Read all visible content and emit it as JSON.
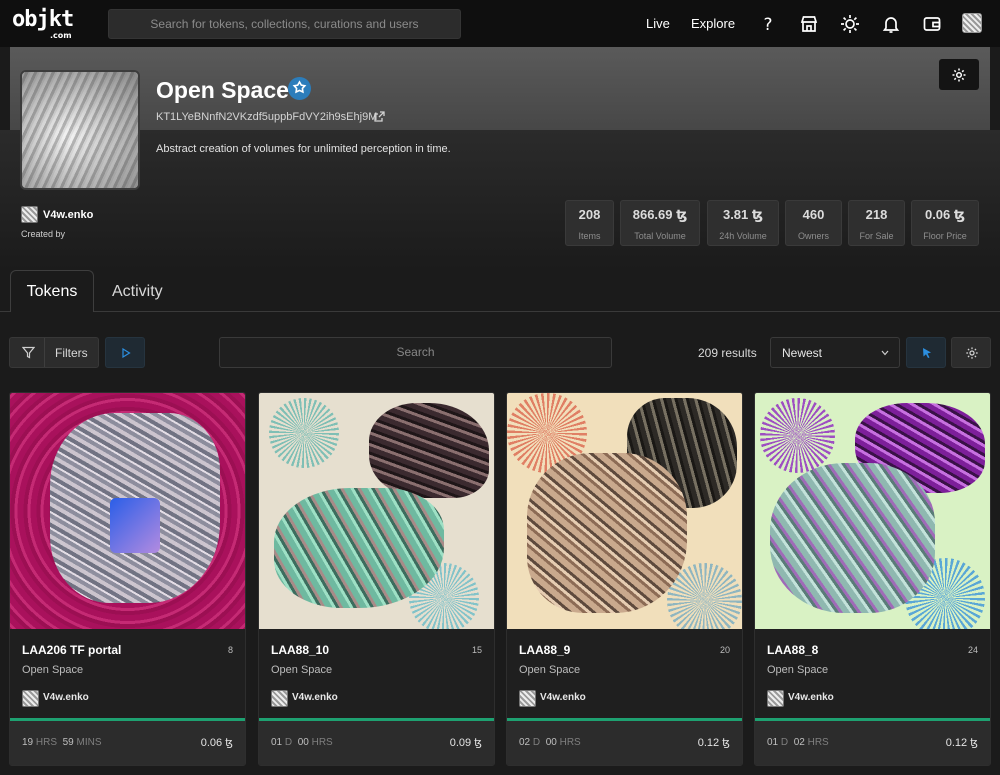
{
  "nav": {
    "logo": "objkt",
    "logo_sub": ".com",
    "search_placeholder": "Search for tokens, collections, curations and users",
    "links": [
      "Live",
      "Explore"
    ],
    "icons": [
      "help-icon",
      "store-icon",
      "theme-icon",
      "bell-icon",
      "wallet-icon",
      "user-avatar"
    ]
  },
  "collection": {
    "title": "Open Space",
    "contract": "KT1LYeBNnfN2VKzdf5uppbFdVY2ih9sEhj9M",
    "description": "Abstract creation of volumes for unlimited perception in time.",
    "creator": "V4w.enko",
    "created_by_label": "Created by"
  },
  "stats": [
    {
      "value": "208",
      "label": "Items"
    },
    {
      "value": "866.69 ꜩ",
      "label": "Total Volume"
    },
    {
      "value": "3.81 ꜩ",
      "label": "24h Volume"
    },
    {
      "value": "460",
      "label": "Owners"
    },
    {
      "value": "218",
      "label": "For Sale"
    },
    {
      "value": "0.06 ꜩ",
      "label": "Floor Price"
    }
  ],
  "tabs": {
    "tokens": "Tokens",
    "activity": "Activity"
  },
  "toolbar": {
    "filters_label": "Filters",
    "search_placeholder": "Search",
    "results": "209 results",
    "sort_value": "Newest"
  },
  "tokens": [
    {
      "name": "LAA206 TF portal",
      "edition": "8",
      "collection": "Open Space",
      "creator": "V4w.enko",
      "time_a": "19",
      "unit_a": "HRS",
      "time_b": "59",
      "unit_b": "MINS",
      "price": "0.06 ꜩ"
    },
    {
      "name": "LAA88_10",
      "edition": "15",
      "collection": "Open Space",
      "creator": "V4w.enko",
      "time_a": "01",
      "unit_a": "D",
      "time_b": "00",
      "unit_b": "HRS",
      "price": "0.09 ꜩ"
    },
    {
      "name": "LAA88_9",
      "edition": "20",
      "collection": "Open Space",
      "creator": "V4w.enko",
      "time_a": "02",
      "unit_a": "D",
      "time_b": "00",
      "unit_b": "HRS",
      "price": "0.12 ꜩ"
    },
    {
      "name": "LAA88_8",
      "edition": "24",
      "collection": "Open Space",
      "creator": "V4w.enko",
      "time_a": "01",
      "unit_a": "D",
      "time_b": "02",
      "unit_b": "HRS",
      "price": "0.12 ꜩ"
    }
  ],
  "colors": {
    "accent_green": "#1ea171",
    "accent_blue": "#2c7dbb",
    "background": "#1b1b1b"
  }
}
